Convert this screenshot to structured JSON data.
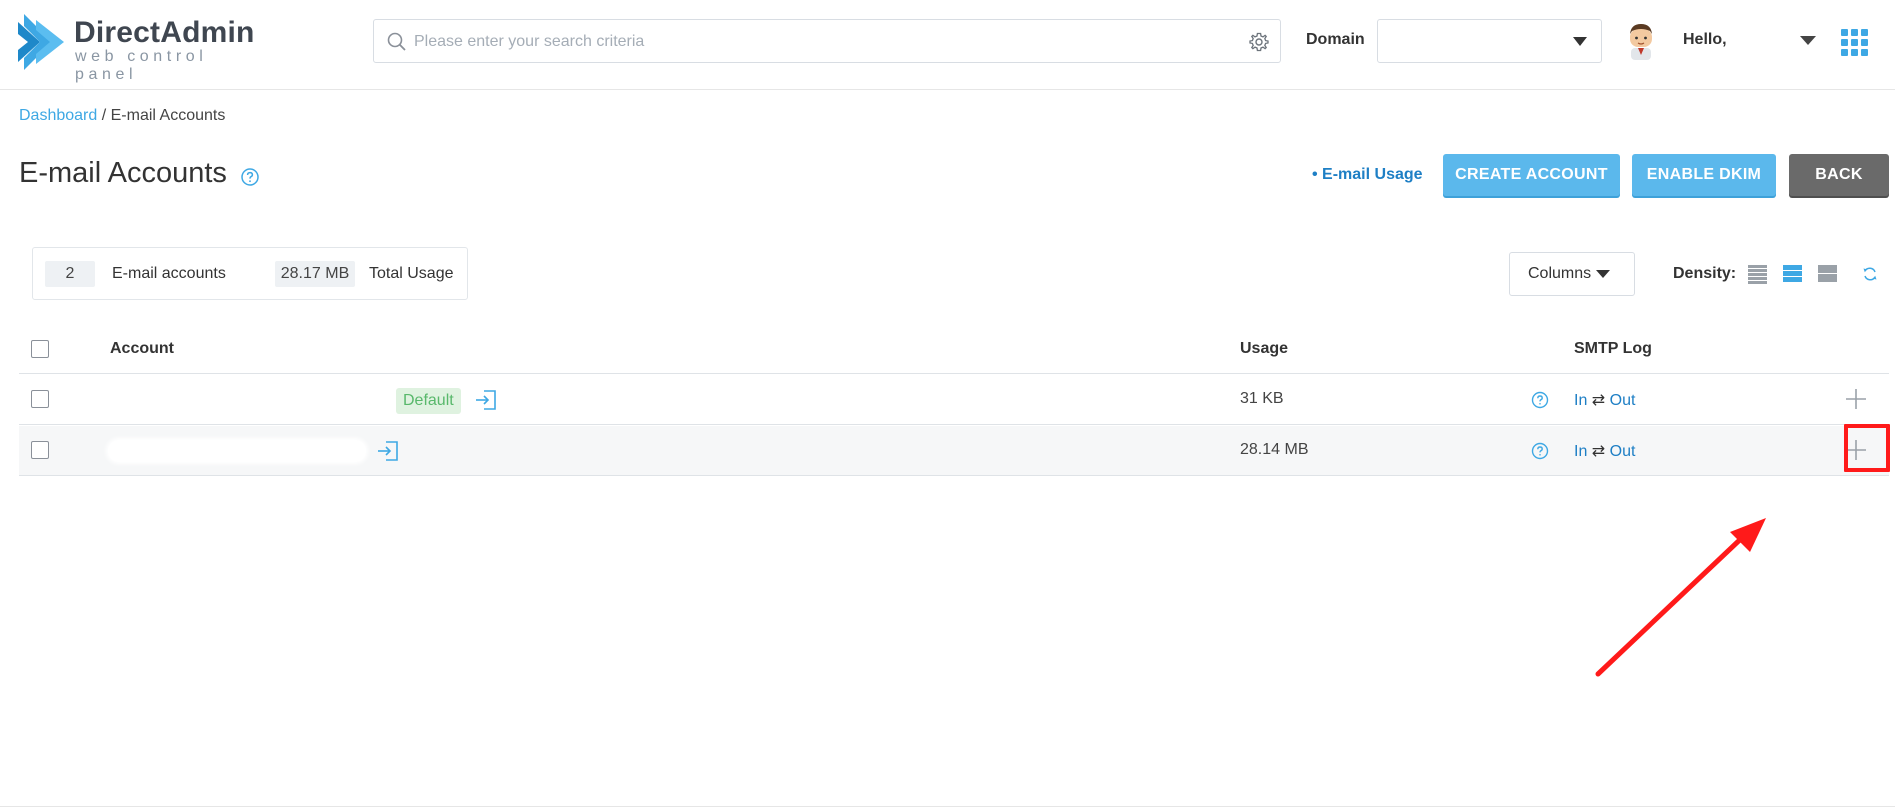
{
  "header": {
    "brand_name": "DirectAdmin",
    "brand_tagline": "web control panel",
    "search_placeholder": "Please enter your search criteria",
    "search_value": "",
    "domain_label": "Domain",
    "domain_value": "",
    "greeting": "Hello,",
    "icons": [
      "search-icon",
      "gear-icon",
      "chevron-down-icon",
      "avatar",
      "apps-grid-icon"
    ]
  },
  "breadcrumb": {
    "root": "Dashboard",
    "separator": " / ",
    "current": "E-mail Accounts"
  },
  "page": {
    "title": "E-mail Accounts",
    "usage_link": "• E-mail Usage",
    "create_button": "CREATE ACCOUNT",
    "dkim_button": "ENABLE DKIM",
    "back_button": "BACK"
  },
  "stats": {
    "accounts_count": "2",
    "accounts_label": "E-mail accounts",
    "total_usage": "28.17 MB",
    "total_usage_label": "Total Usage"
  },
  "toolbar": {
    "columns_label": "Columns",
    "density_label": "Density:",
    "density_selected": "medium"
  },
  "table": {
    "headers": {
      "account": "Account",
      "usage": "Usage",
      "smtp_log": "SMTP Log"
    },
    "rows": [
      {
        "account": "",
        "badge": "Default",
        "usage": "31 KB",
        "smtp_in": "In",
        "smtp_sep": " ⇄ ",
        "smtp_out": "Out"
      },
      {
        "account": "",
        "badge": "",
        "usage": "28.14 MB",
        "smtp_in": "In",
        "smtp_sep": " ⇄ ",
        "smtp_out": "Out"
      }
    ]
  },
  "colors": {
    "accent": "#3ea8e4",
    "button_primary": "#5bb8ec",
    "button_back": "#6a6a6a",
    "link": "#1e7fc5",
    "badge_bg": "#dff2e0",
    "badge_text": "#58b86b",
    "annotation": "#ff1a1a"
  }
}
